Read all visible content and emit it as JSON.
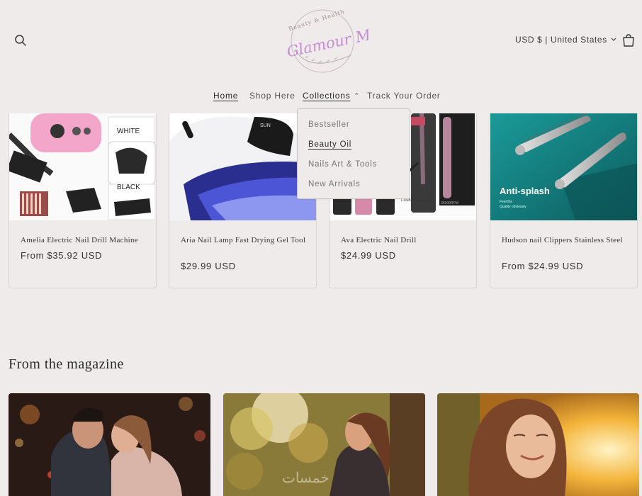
{
  "header": {
    "logo_text": "Glamour Mart",
    "logo_tagline": "Beauty & Health",
    "locale": "USD $ | United States"
  },
  "nav": {
    "items": [
      {
        "label": "Home"
      },
      {
        "label": "Shop Here"
      },
      {
        "label": "Collections"
      },
      {
        "label": "Track Your Order"
      }
    ]
  },
  "collections_menu": {
    "items": [
      {
        "label": "Bestseller"
      },
      {
        "label": "Beauty Oil"
      },
      {
        "label": "Nails Art & Tools"
      },
      {
        "label": "New Arrivals"
      }
    ]
  },
  "products": [
    {
      "title": "Amelia Electric Nail Drill Machine",
      "price": "From $35.92 USD",
      "img_text_1": "WHITE",
      "img_text_2": "BLACK"
    },
    {
      "title": "Aria Nail Lamp Fast Drying Gel Tool",
      "price": "$29.99 USD",
      "img_text_1": "SUN"
    },
    {
      "title": "Ava Electric Nail Drill",
      "price": "$24.99 USD",
      "img_text_1": "T-USB Controllable",
      "img_text_2": "35000RPM"
    },
    {
      "title": "Hudson nail Clippers Stainless Steel",
      "price": "From $24.99 USD",
      "img_text_1": "Anti-splash",
      "img_text_2": "Feel the",
      "img_text_3": "Quality obviously"
    }
  ],
  "magazine": {
    "title": "From the magazine"
  },
  "watermark": "خمسات",
  "colors": {
    "background": "#efebea",
    "accent_logo": "#c58bd6",
    "card_border": "#d9d4d3",
    "teal_banner": "#1b8a8a"
  }
}
